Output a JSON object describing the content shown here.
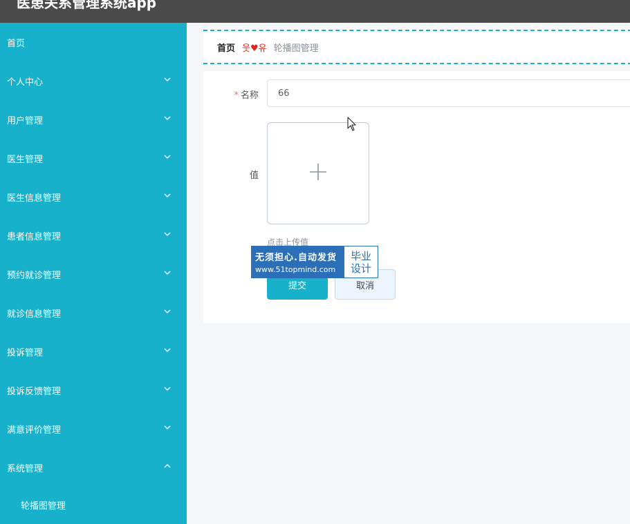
{
  "app": {
    "title": "医患关系管理系统app"
  },
  "sidebar": {
    "items": [
      {
        "label": "首页",
        "chevron": "none"
      },
      {
        "label": "个人中心",
        "chevron": "down"
      },
      {
        "label": "用户管理",
        "chevron": "down"
      },
      {
        "label": "医生管理",
        "chevron": "down"
      },
      {
        "label": "医生信息管理",
        "chevron": "down"
      },
      {
        "label": "患者信息管理",
        "chevron": "down"
      },
      {
        "label": "预约就诊管理",
        "chevron": "down"
      },
      {
        "label": "就诊信息管理",
        "chevron": "down"
      },
      {
        "label": "投诉管理",
        "chevron": "down"
      },
      {
        "label": "投诉反馈管理",
        "chevron": "down"
      },
      {
        "label": "满意评价管理",
        "chevron": "down"
      },
      {
        "label": "系统管理",
        "chevron": "up"
      }
    ],
    "subitems": [
      {
        "label": "轮播图管理"
      }
    ]
  },
  "breadcrumb": {
    "home": "首页",
    "separator_left": "웃",
    "separator_heart": "♥",
    "separator_right": "유",
    "current": "轮播图管理"
  },
  "form": {
    "required_mark": "*",
    "name_label": "名称",
    "name_value": "66",
    "value_label": "值",
    "upload_hint": "点击上传值",
    "submit_label": "提交",
    "cancel_label": "取消"
  },
  "watermark": {
    "line1": "无须担心.自动发货",
    "line2": "www.51topmind.com",
    "right_top": "毕业",
    "right_bottom": "设计"
  },
  "colors": {
    "sidebar": "#17b1cc",
    "topbar": "#4a4a4a",
    "accent": "#17b1cc",
    "breadcrumb_separator": "#e0261b",
    "watermark": "#2a6fb8"
  }
}
